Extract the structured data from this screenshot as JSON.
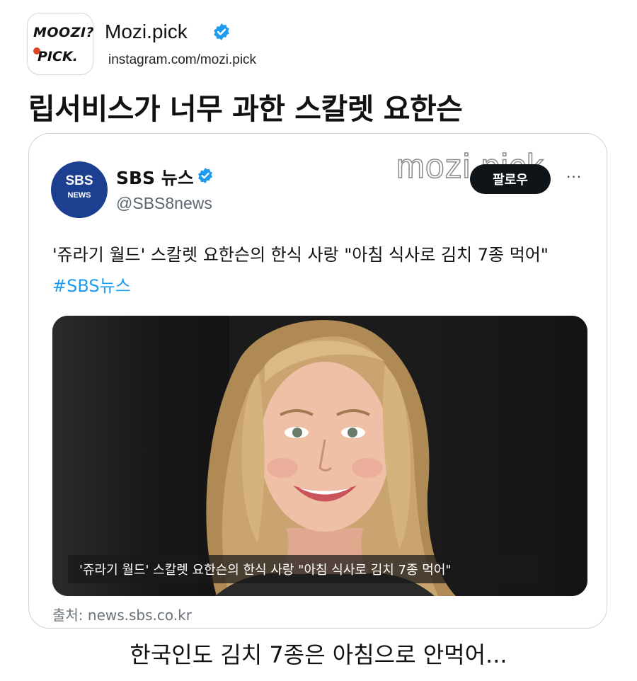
{
  "header": {
    "logo_line1": "MOOZI?",
    "logo_line2": "PICK.",
    "account_name": "Mozi.pick",
    "account_url": "instagram.com/mozi.pick"
  },
  "headline": "립서비스가 너무 과한 스칼렛 요한슨",
  "tweet": {
    "avatar_line1": "SBS",
    "avatar_line2": "NEWS",
    "name": "SBS 뉴스",
    "handle": "@SBS8news",
    "follow_label": "팔로우",
    "more_label": "···",
    "watermark": "mozi.pick",
    "text": "'쥬라기 월드' 스칼렛 요한슨의 한식 사랑 \"아침 식사로 김치 7종 먹어\" ",
    "hashtag": "#SBS뉴스",
    "image_caption": "'쥬라기 월드' 스칼렛 요한슨의 한식 사랑 \"아침 식사로 김치 7종 먹어\"",
    "source": "출처: news.sbs.co.kr"
  },
  "footer": "한국인도 김치 7종은 아침으로 안먹어...",
  "colors": {
    "verified_blue": "#1d9bf0",
    "sbs_blue": "#1d3f8f",
    "follow_button": "#0f1419"
  }
}
